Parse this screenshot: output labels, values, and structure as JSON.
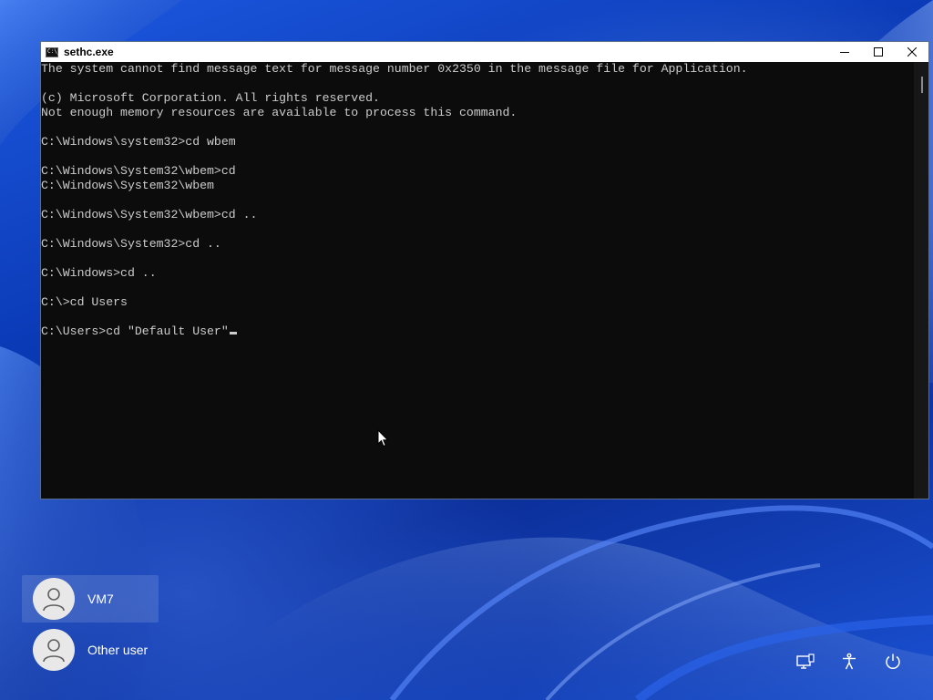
{
  "window": {
    "title": "sethc.exe",
    "icon_text": "C:\\_"
  },
  "console": {
    "lines": [
      "The system cannot find message text for message number 0x2350 in the message file for Application.",
      "",
      "(c) Microsoft Corporation. All rights reserved.",
      "Not enough memory resources are available to process this command.",
      "",
      "C:\\Windows\\system32>cd wbem",
      "",
      "C:\\Windows\\System32\\wbem>cd",
      "C:\\Windows\\System32\\wbem",
      "",
      "C:\\Windows\\System32\\wbem>cd ..",
      "",
      "C:\\Windows\\System32>cd ..",
      "",
      "C:\\Windows>cd ..",
      "",
      "C:\\>cd Users",
      "",
      "C:\\Users>cd \"Default User\""
    ]
  },
  "login": {
    "users": [
      {
        "name": "VM7",
        "selected": true
      },
      {
        "name": "Other user",
        "selected": false
      }
    ]
  },
  "tray": {
    "icons": [
      "network-icon",
      "accessibility-icon",
      "power-icon"
    ]
  },
  "colors": {
    "console_bg": "#0c0c0c",
    "console_fg": "#cccccc",
    "wallpaper_blue": "#0b3db3"
  }
}
